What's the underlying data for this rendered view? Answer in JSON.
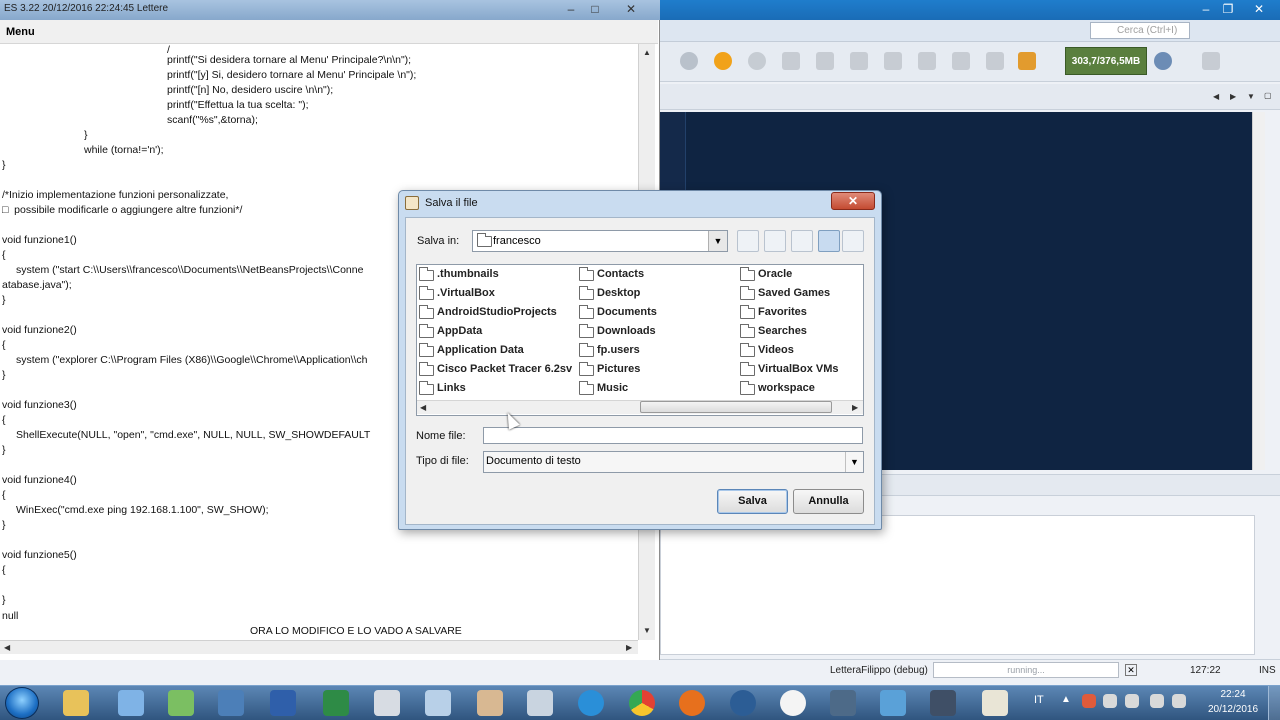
{
  "editor_window": {
    "title": "ES 3.22 20/12/2016 22:24:45  Lettere",
    "menu": "Menu",
    "code_lines": [
      "/",
      "printf(\"Si desidera tornare al Menu' Principale?\\n\\n\");",
      "printf(\"[y] Si, desidero tornare al Menu' Principale \\n\");",
      "printf(\"[n] No, desidero uscire \\n\\n\");",
      "printf(\"Effettua la tua scelta: \");",
      "scanf(\"%s\",&torna);",
      "}",
      "while (torna!='n');",
      "}",
      "/*Inizio implementazione funzioni personalizzate,",
      "□  possibile modificarle o aggiungere altre funzioni*/",
      "void funzione1()",
      "{",
      "system (\"start C:\\\\Users\\\\francesco\\\\Documents\\\\NetBeansProjects\\\\Conne",
      "atabase.java\");",
      "}",
      "void funzione2()",
      "{",
      "system (\"explorer C:\\\\Program Files (X86)\\\\Google\\\\Chrome\\\\Application\\\\ch",
      "}",
      "void funzione3()",
      "{",
      "ShellExecute(NULL, \"open\", \"cmd.exe\", NULL, NULL, SW_SHOWDEFAULT",
      "}",
      "void funzione4()",
      "{",
      "WinExec(\"cmd.exe ping 192.168.1.100\", SW_SHOW);",
      "}",
      "void funzione5()",
      "{",
      "}",
      "null",
      "ORA LO MODIFICO E LO VADO A SALVARE"
    ]
  },
  "ide": {
    "search_placeholder": "Cerca (Ctrl+I)",
    "memory": "303,7/376,5MB",
    "status_project": "LetteraFilippo (debug)",
    "status_progress": "running...",
    "status_position": "127:22",
    "status_mode": "INS",
    "editor_color": "#0f2442"
  },
  "dialog": {
    "title": "Salva il file",
    "look_in_label": "Salva in:",
    "look_in_value": "francesco",
    "files": [
      [
        ".thumbnails",
        ".VirtualBox",
        "AndroidStudioProjects",
        "AppData",
        "Application Data",
        "Cisco Packet Tracer 6.2sv",
        "Links"
      ],
      [
        "Contacts",
        "Desktop",
        "Documents",
        "Downloads",
        "fp.users",
        "Pictures",
        "Music"
      ],
      [
        "Oracle",
        "Saved Games",
        "Favorites",
        "Searches",
        "Videos",
        "VirtualBox VMs",
        "workspace"
      ]
    ],
    "filename_label": "Nome file:",
    "filename_value": "",
    "filetype_label": "Tipo di file:",
    "filetype_value": "Documento di testo",
    "save_button": "Salva",
    "cancel_button": "Annulla",
    "close_glyph": "✕"
  },
  "taskbar": {
    "language": "IT",
    "time": "22:24",
    "date": "20/12/2016"
  }
}
